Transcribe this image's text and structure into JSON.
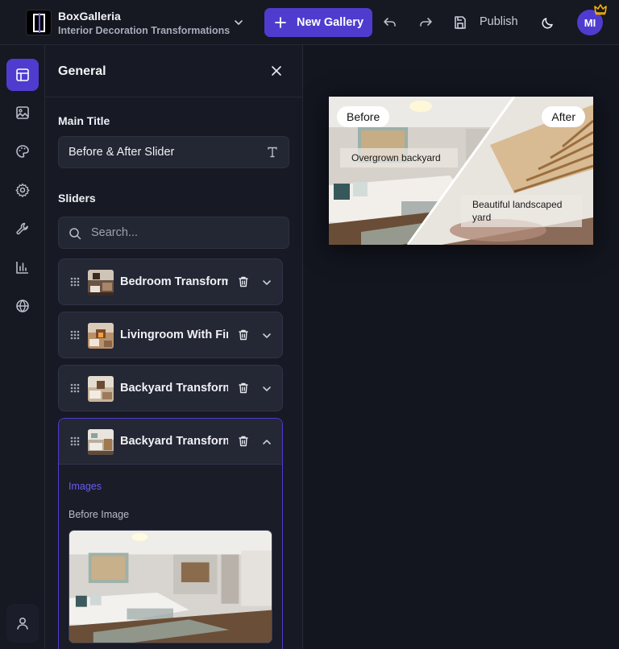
{
  "header": {
    "brand_title": "BoxGalleria",
    "brand_subtitle": "Interior Decoration Transformations",
    "new_gallery_label": "New Gallery",
    "publish_label": "Publish",
    "avatar_initials": "MI"
  },
  "panel": {
    "title": "General",
    "main_title_label": "Main Title",
    "main_title_value": "Before & After Slider",
    "sliders_label": "Sliders",
    "search_placeholder": "Search..."
  },
  "sliders": [
    {
      "name": "Bedroom Transformation"
    },
    {
      "name": "Livingroom With Fireplace"
    },
    {
      "name": "Backyard Transformation"
    },
    {
      "name": "Backyard Transformation"
    }
  ],
  "expanded_slider": {
    "section_label": "Images",
    "before_image_label": "Before Image"
  },
  "preview": {
    "before_label": "Before",
    "after_label": "After",
    "before_caption": "Overgrown backyard",
    "after_caption": "Beautiful landscaped yard"
  },
  "colors": {
    "accent": "#4f3ccf",
    "background": "#13151f",
    "panel": "#171924"
  }
}
